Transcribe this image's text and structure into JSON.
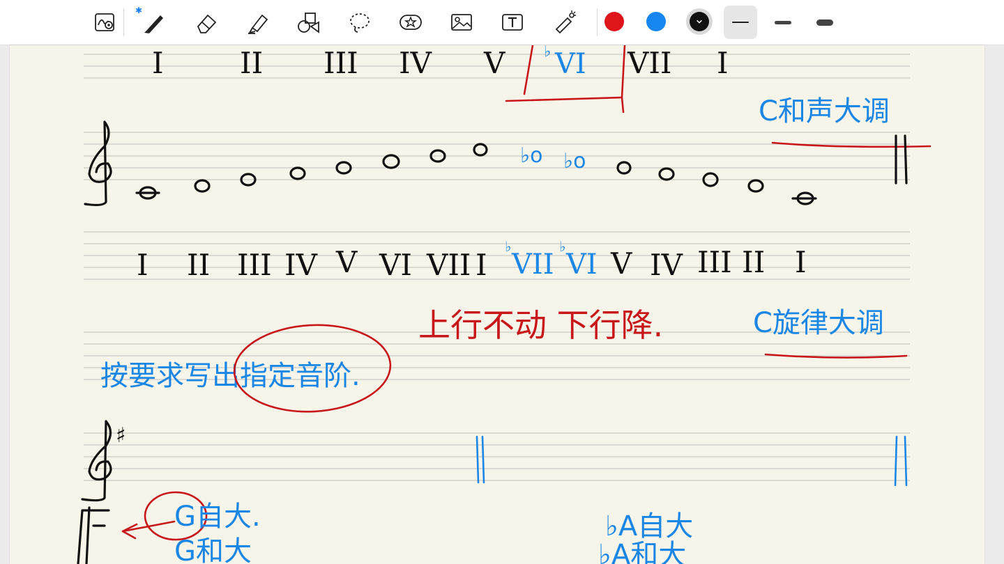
{
  "toolbar": {
    "bluetooth_symbol": "✱",
    "tools": [
      {
        "name": "zoom-lasso-icon"
      },
      {
        "name": "pen-icon"
      },
      {
        "name": "eraser-icon"
      },
      {
        "name": "highlighter-icon"
      },
      {
        "name": "shapes-icon"
      },
      {
        "name": "lasso-icon"
      },
      {
        "name": "sticker-icon"
      },
      {
        "name": "image-icon"
      },
      {
        "name": "text-icon"
      },
      {
        "name": "laser-pointer-icon"
      }
    ],
    "colors": [
      {
        "name": "red",
        "value": "#e0151b"
      },
      {
        "name": "blue",
        "value": "#1786f0"
      },
      {
        "name": "black",
        "value": "#111111",
        "selected": true
      }
    ],
    "stroke_widths": [
      {
        "name": "thin",
        "selected": true
      },
      {
        "name": "medium"
      },
      {
        "name": "thick"
      }
    ]
  },
  "notes": {
    "row1_numerals": [
      "I",
      "II",
      "III",
      "IV",
      "V",
      "VI",
      "VII",
      "I"
    ],
    "row1_flat_index": 5,
    "harmonic_label": "C和声大调",
    "row2_numerals": [
      "I",
      "II",
      "III",
      "IV",
      "V",
      "VI",
      "VII",
      "I",
      "VII",
      "VI",
      "V",
      "IV",
      "III",
      "II",
      "I"
    ],
    "row2_flat_indices": [
      8,
      9
    ],
    "flat_sign": "♭",
    "sharp_sign": "♯",
    "red_rule": "上行不动 下行降.",
    "melodic_label": "C旋律大调",
    "instruction": "按要求写出指定音阶.",
    "g_major_natural": "G自大.",
    "g_major_harmonic": "G和大",
    "ab_major_natural": "♭A自大",
    "ab_major_harmonic": "♭A和大"
  },
  "colors": {
    "paper": "#f7f5ea",
    "ink_black": "#111111",
    "ink_blue": "#1a86e6",
    "ink_red": "#c8171b",
    "staff_line": "#c9c9c4"
  }
}
